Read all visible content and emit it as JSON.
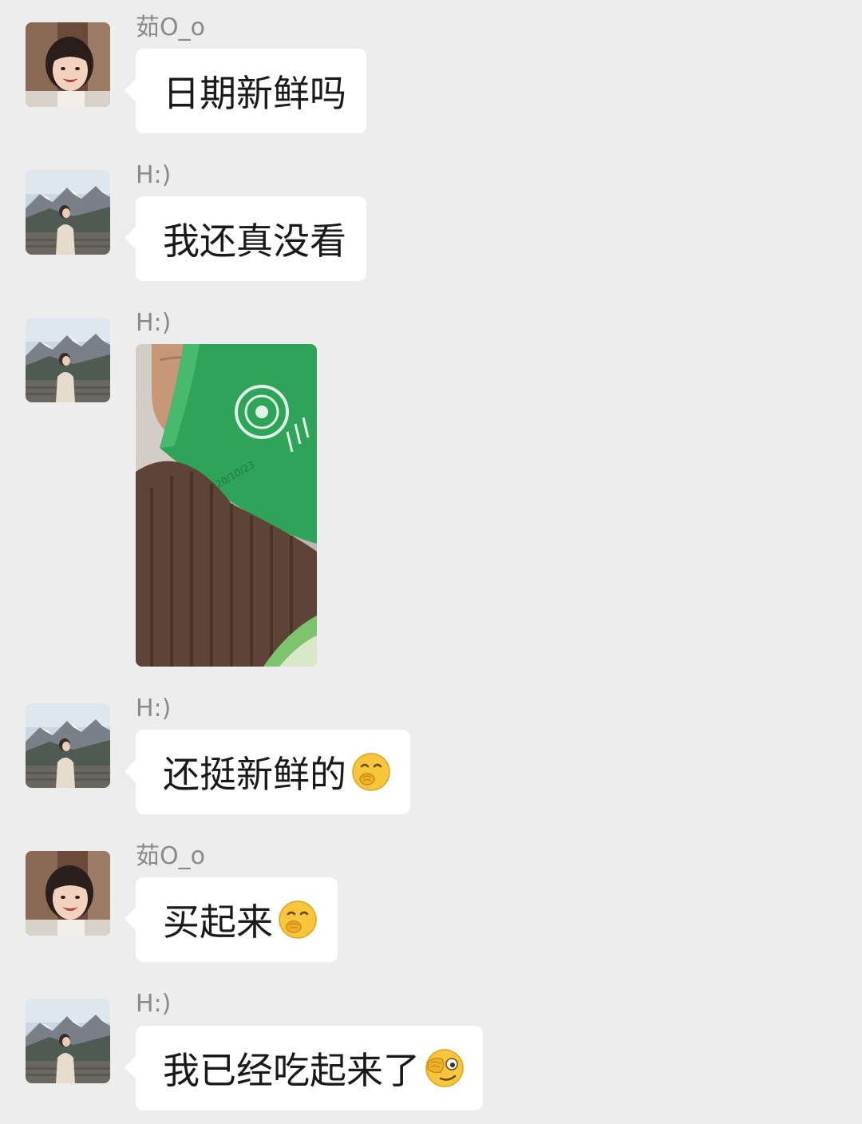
{
  "messages": [
    {
      "sender": "茹O_o",
      "text": "日期新鲜吗",
      "emoji": "",
      "avatar": "avatar-girl"
    },
    {
      "sender": "H:)",
      "text": "我还真没看",
      "emoji": "",
      "avatar": "avatar-mountain"
    },
    {
      "sender": "H:)",
      "image": "photo-green-package",
      "image_text": "2020/10/23",
      "avatar": "avatar-mountain"
    },
    {
      "sender": "H:)",
      "text": "还挺新鲜的",
      "emoji": "giggle-emoji",
      "avatar": "avatar-mountain"
    },
    {
      "sender": "茹O_o",
      "text": "买起来",
      "emoji": "giggle-emoji",
      "avatar": "avatar-girl"
    },
    {
      "sender": "H:)",
      "text": "我已经吃起来了",
      "emoji": "facepalm-peek-emoji",
      "avatar": "avatar-mountain"
    }
  ],
  "colors": {
    "background": "#ededed",
    "bubble": "#ffffff",
    "sender_text": "#8a8a8a",
    "message_text": "#191919",
    "package_green": "#2fa358"
  }
}
